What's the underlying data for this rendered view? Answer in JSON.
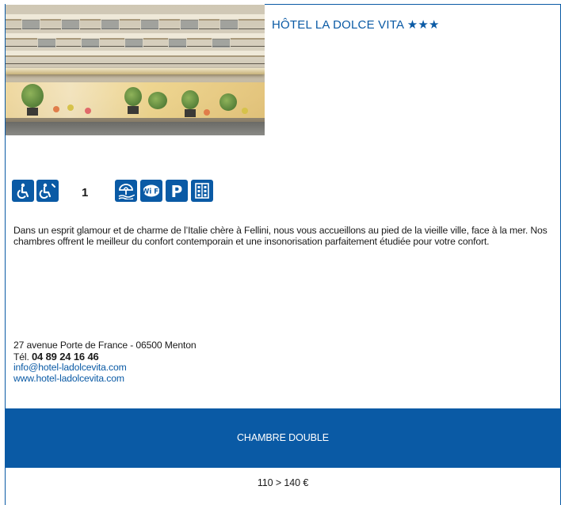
{
  "hotel": {
    "name": "HÔTEL LA DOLCE VITA",
    "stars": "★★★",
    "accessible_rooms_count": "1",
    "description": "Dans un esprit glamour et de charme de l’Italie chère à Fellini, nous vous accueillons au pied de la vieille ville, face à la mer. Nos chambres offrent le meilleur du confort contemporain et une insonorisation parfaitement étudiée pour votre confort."
  },
  "icons": [
    {
      "name": "wheelchair-access-icon"
    },
    {
      "name": "wheelchair-assisted-icon"
    },
    {
      "name": "beach-umbrella-icon"
    },
    {
      "name": "wifi-icon"
    },
    {
      "name": "parking-icon"
    },
    {
      "name": "elevator-icon"
    }
  ],
  "contact": {
    "address": "27 avenue Porte de France - 06500 Menton",
    "tel_label": "Tél.",
    "tel_number": "04 89 24 16 46",
    "email": "info@hotel-ladolcevita.com",
    "website": "www.hotel-ladolcevita.com"
  },
  "rates": {
    "room_type": "CHAMBRE DOUBLE",
    "price": "110 > 140 €"
  },
  "colors": {
    "brand_blue": "#0a5aa5"
  }
}
